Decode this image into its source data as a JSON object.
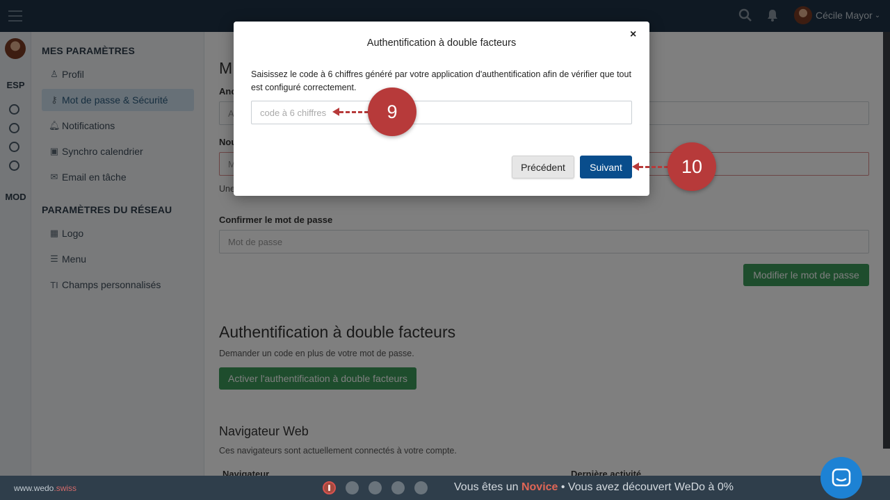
{
  "colors": {
    "topbar": "#1f3346",
    "accent_green": "#3c9a5a",
    "primary_blue": "#094d8c",
    "callout_red": "#b73a3a",
    "novice_red": "#e06656"
  },
  "topbar": {
    "user_name": "Cécile Mayor",
    "chevron": "⌄"
  },
  "rail": {
    "esp": "ESP",
    "mod": "MOD"
  },
  "sidebar": {
    "section1": "MES PARAMÈTRES",
    "items1": [
      {
        "label": "Profil",
        "icon": "user-icon",
        "glyph": "♙"
      },
      {
        "label": "Mot de passe & Sécurité",
        "icon": "key-icon",
        "glyph": "⚷"
      },
      {
        "label": "Notifications",
        "icon": "bell-icon",
        "glyph": "🔔︎"
      },
      {
        "label": "Synchro calendrier",
        "icon": "calendar-icon",
        "glyph": "▣"
      },
      {
        "label": "Email en tâche",
        "icon": "envelope-icon",
        "glyph": "✉"
      }
    ],
    "section2": "PARAMÈTRES DU RÉSEAU",
    "items2": [
      {
        "label": "Logo",
        "icon": "building-icon",
        "glyph": "▦"
      },
      {
        "label": "Menu",
        "icon": "menu-icon",
        "glyph": "☰"
      },
      {
        "label": "Champs personnalisés",
        "icon": "text-icon",
        "glyph": "TI"
      }
    ]
  },
  "main": {
    "title_partial": "M",
    "label_old_partial": "Anc",
    "input_old_partial": "A",
    "label_new_partial": "Nou",
    "input_new_partial": "M",
    "hint_partial": "Une",
    "confirm_label": "Confirmer le mot de passe",
    "confirm_placeholder": "Mot de passe",
    "change_password_button": "Modifier le mot de passe",
    "twofa_heading": "Authentification à double facteurs",
    "twofa_desc": "Demander un code en plus de votre mot de passe.",
    "twofa_button": "Activer l'authentification à double facteurs",
    "browser_heading": "Navigateur Web",
    "browser_desc": "Ces navigateurs sont actuellement connectés à votre compte.",
    "col_browser": "Navigateur",
    "col_last_activity": "Dernière activité"
  },
  "modal": {
    "title": "Authentification à double facteurs",
    "close": "×",
    "description": "Saisissez le code à 6 chiffres généré par votre application d'authentification afin de vérifier que tout est configuré correctement.",
    "code_placeholder": "code à 6 chiffres",
    "code_value": "",
    "previous_button": "Précédent",
    "next_button": "Suivant"
  },
  "callouts": {
    "step9": "9",
    "step10": "10"
  },
  "footer": {
    "brand_main": "www.wedo",
    "brand_suffix": ".swiss",
    "prefix": "Vous êtes un ",
    "level": "Novice",
    "suffix": " • Vous avez découvert WeDo à 0%"
  }
}
